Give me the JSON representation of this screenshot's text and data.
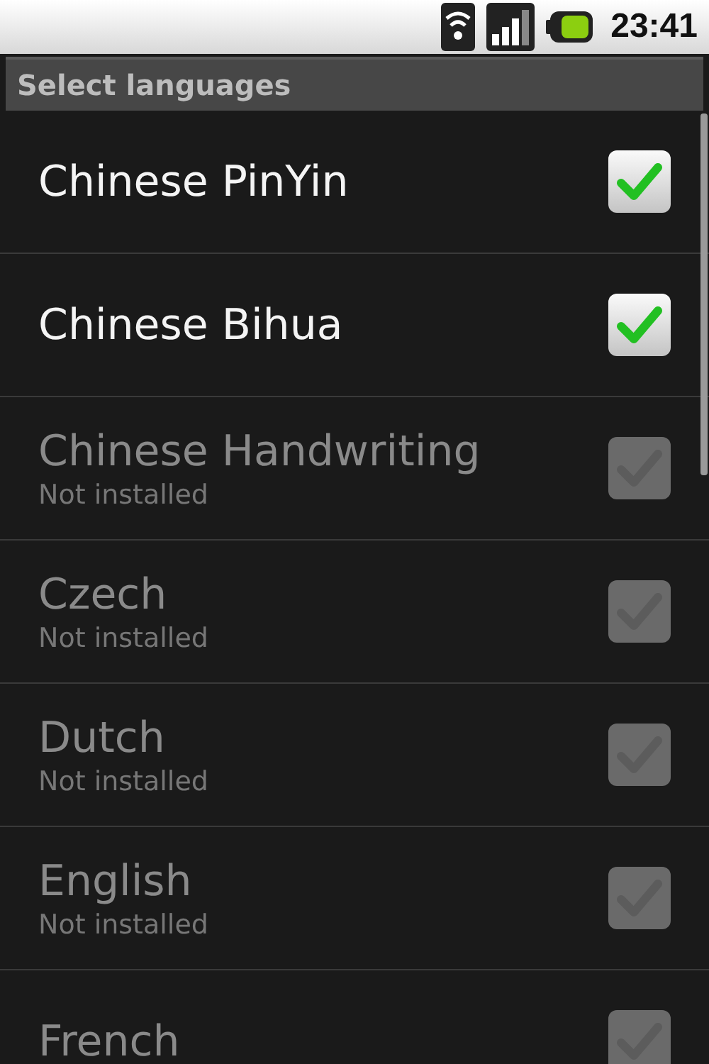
{
  "status_bar": {
    "time": "23:41"
  },
  "title": "Select languages",
  "languages": [
    {
      "name": "Chinese PinYin",
      "checked": true,
      "disabled": false
    },
    {
      "name": "Chinese Bihua",
      "checked": true,
      "disabled": false
    },
    {
      "name": "Chinese Handwriting",
      "subtitle": "Not installed",
      "checked": false,
      "disabled": true
    },
    {
      "name": "Czech",
      "subtitle": "Not installed",
      "checked": false,
      "disabled": true
    },
    {
      "name": "Dutch",
      "subtitle": "Not installed",
      "checked": false,
      "disabled": true
    },
    {
      "name": "English",
      "subtitle": "Not installed",
      "checked": false,
      "disabled": true
    },
    {
      "name": "French",
      "checked": false,
      "disabled": true
    }
  ]
}
